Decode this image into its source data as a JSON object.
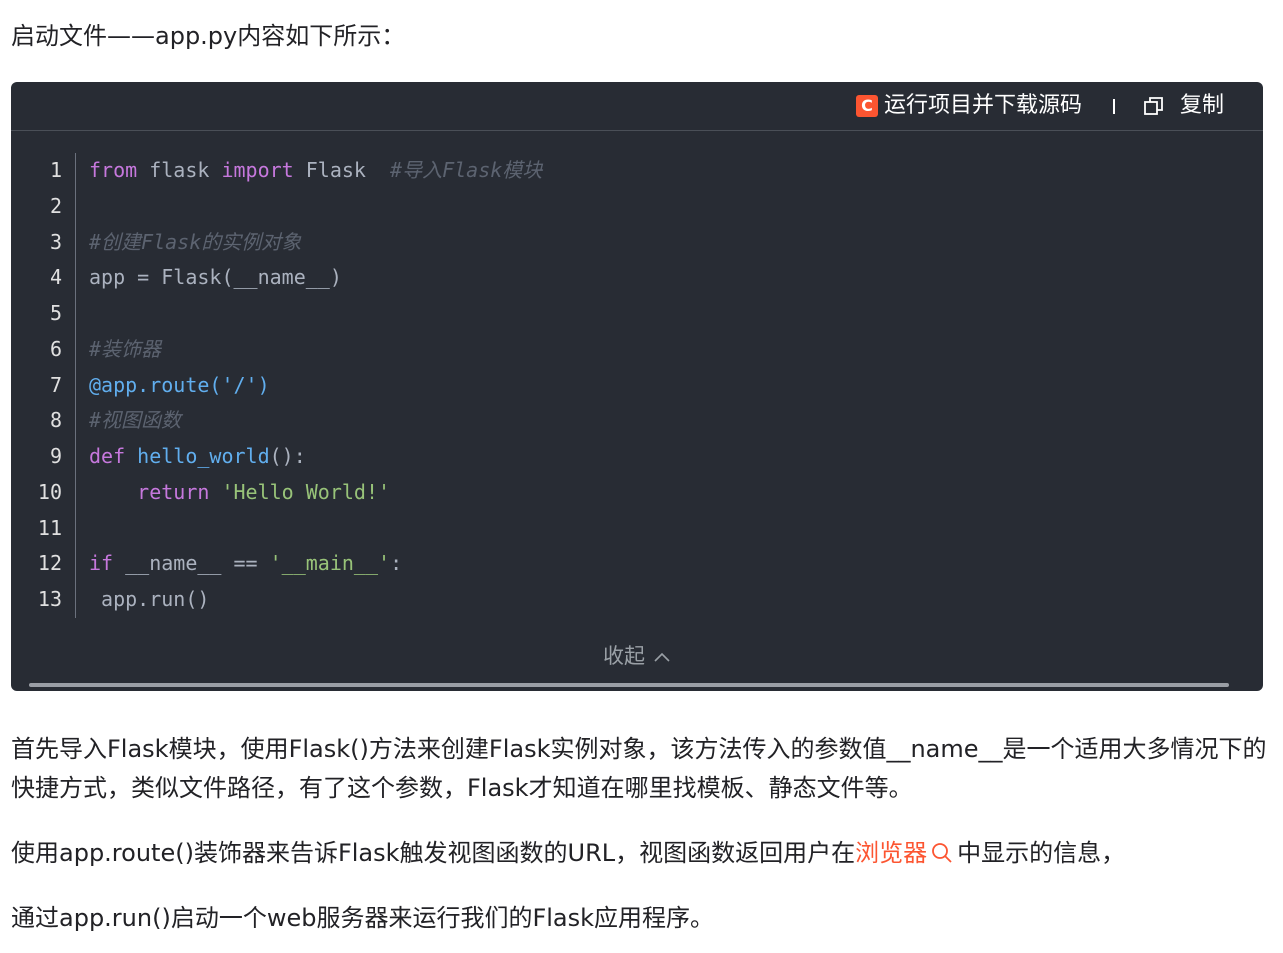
{
  "intro": "启动文件——app.py内容如下所示：",
  "toolbar": {
    "run_badge": "C",
    "run_label": "运行项目并下载源码",
    "copy_label": "复制"
  },
  "code": {
    "lines": [
      {
        "n": "1",
        "parts": [
          [
            "kw",
            "from"
          ],
          [
            "p",
            " flask "
          ],
          [
            "kw",
            "import"
          ],
          [
            "p",
            " Flask  "
          ],
          [
            "cm",
            "#导入Flask模块"
          ]
        ]
      },
      {
        "n": "2",
        "parts": []
      },
      {
        "n": "3",
        "parts": [
          [
            "cm",
            "#创建Flask的实例对象"
          ]
        ]
      },
      {
        "n": "4",
        "parts": [
          [
            "p",
            "app = Flask(__name__)"
          ]
        ]
      },
      {
        "n": "5",
        "parts": []
      },
      {
        "n": "6",
        "parts": [
          [
            "cm",
            "#装饰器"
          ]
        ]
      },
      {
        "n": "7",
        "parts": [
          [
            "fn",
            "@app.route"
          ],
          [
            "fn",
            "('/')"
          ]
        ]
      },
      {
        "n": "8",
        "parts": [
          [
            "cm",
            "#视图函数"
          ]
        ]
      },
      {
        "n": "9",
        "parts": [
          [
            "kw",
            "def"
          ],
          [
            "p",
            " "
          ],
          [
            "fn",
            "hello_world"
          ],
          [
            "p",
            "():"
          ]
        ]
      },
      {
        "n": "10",
        "parts": [
          [
            "p",
            "    "
          ],
          [
            "kw",
            "return"
          ],
          [
            "p",
            " "
          ],
          [
            "str",
            "'Hello World!'"
          ]
        ]
      },
      {
        "n": "11",
        "parts": []
      },
      {
        "n": "12",
        "parts": [
          [
            "kw",
            "if"
          ],
          [
            "p",
            " __name__ == "
          ],
          [
            "str",
            "'__main__'"
          ],
          [
            "p",
            ":"
          ]
        ]
      },
      {
        "n": "13",
        "parts": [
          [
            "p",
            " app.run()"
          ]
        ]
      }
    ],
    "collapse_label": "收起",
    "collapse_icon": "chevron-up-icon"
  },
  "paragraphs": {
    "p1": "首先导入Flask模块，使用Flask()方法来创建Flask实例对象，该方法传入的参数值__name__是一个适用大多情况下的快捷方式，类似文件路径，有了这个参数，Flask才知道在哪里找模板、静态文件等。",
    "p2_before": "使用app.route()装饰器来告诉Flask触发视图函数的URL，视图函数返回用户在",
    "p2_link": "浏览器",
    "p2_after": "中显示的信息，",
    "p3": "通过app.run()启动一个web服务器来运行我们的Flask应用程序。"
  },
  "colors": {
    "code_bg": "#282c34",
    "accent": "#fc5531",
    "keyword": "#c678dd",
    "function": "#61aeee",
    "string": "#98c379",
    "comment": "#5c6370"
  }
}
